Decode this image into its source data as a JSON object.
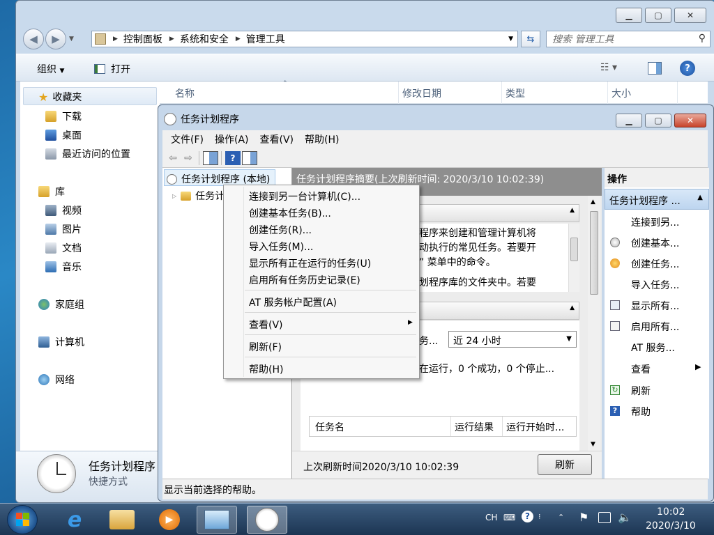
{
  "explorer": {
    "address": {
      "segments": [
        "控制面板",
        "系统和安全",
        "管理工具"
      ]
    },
    "search_placeholder": "搜索 管理工具",
    "toolbar": {
      "organize": "组织",
      "open": "打开"
    },
    "nav": {
      "favorites": "收藏夹",
      "downloads": "下载",
      "desktop": "桌面",
      "recent": "最近访问的位置",
      "libraries": "库",
      "videos": "视频",
      "pictures": "图片",
      "documents": "文档",
      "music": "音乐",
      "homegroup": "家庭组",
      "computer": "计算机",
      "network": "网络"
    },
    "columns": {
      "name": "名称",
      "modified": "修改日期",
      "type": "类型",
      "size": "大小"
    },
    "details": {
      "title": "任务计划程序",
      "subtitle": "快捷方式"
    }
  },
  "task_scheduler": {
    "title": "任务计划程序",
    "menubar": [
      "文件(F)",
      "操作(A)",
      "查看(V)",
      "帮助(H)"
    ],
    "tree": {
      "root": "任务计划程序 (本地)",
      "child": "任务计"
    },
    "summary_header": "任务计划程序摘要(上次刷新时间: 2020/3/10 10:02:39)",
    "overview_lines": [
      "程序来创建和管理计算机将",
      "动执行的常见任务。若要开",
      "” 菜单中的命令。",
      "划程序库的文件夹中。若要"
    ],
    "status_label": "务...",
    "period_value": "近 24 小时",
    "status_summary": "在运行，0 个成功，0 个停止...",
    "table_headers": [
      "任务名",
      "运行结果",
      "运行开始时..."
    ],
    "last_refresh": "上次刷新时间2020/3/10 10:02:39",
    "refresh_button": "刷新",
    "statusbar": "显示当前选择的帮助。",
    "actions": {
      "header": "操作",
      "group": "任务计划程序 ...",
      "items": [
        "连接到另...",
        "创建基本...",
        "创建任务...",
        "导入任务...",
        "显示所有...",
        "启用所有...",
        "AT 服务...",
        "查看",
        "刷新",
        "帮助"
      ]
    }
  },
  "context_menu": {
    "items": [
      "连接到另一台计算机(C)...",
      "创建基本任务(B)...",
      "创建任务(R)...",
      "导入任务(M)...",
      "显示所有正在运行的任务(U)",
      "启用所有任务历史记录(E)",
      "AT 服务帐户配置(A)",
      "查看(V)",
      "刷新(F)",
      "帮助(H)"
    ]
  },
  "taskbar": {
    "lang": "CH",
    "time": "10:02",
    "date": "2020/3/10"
  }
}
